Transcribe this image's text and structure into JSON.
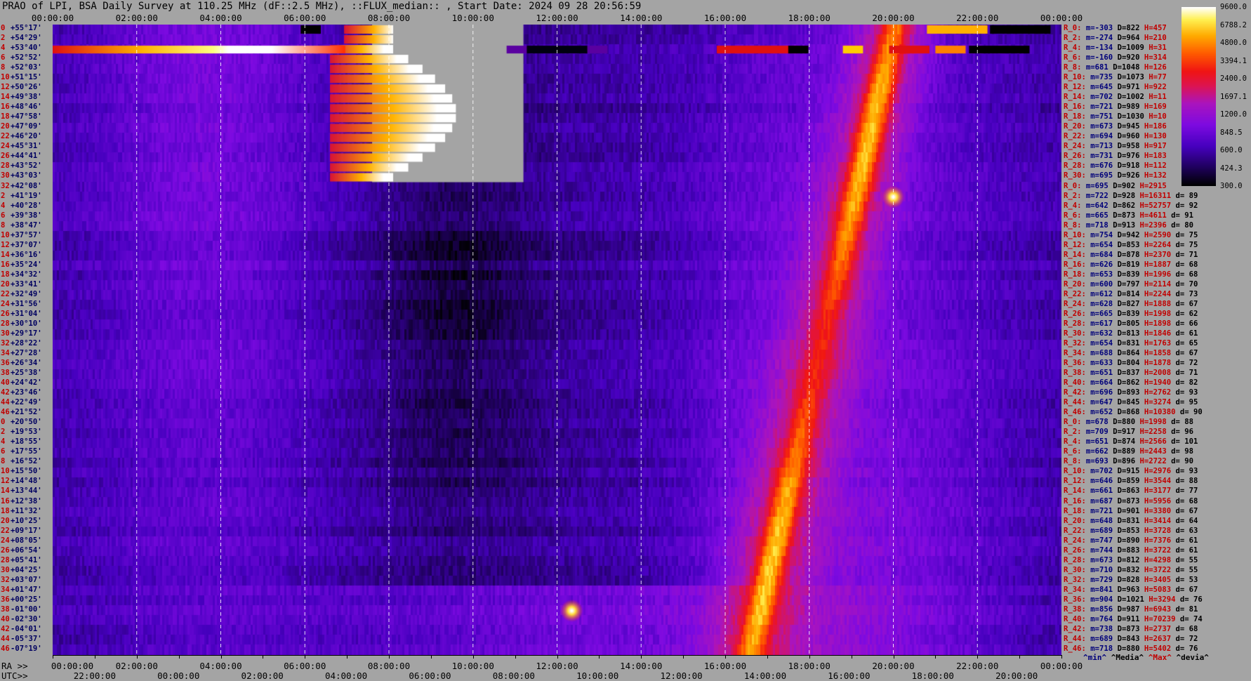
{
  "title": "PRAO of LPI, BSA Daily Survey at 110.25 MHz (dF::2.5 MHz), ::FLUX_median:: , Start Date: 2024 09 28 20:56:59",
  "colors": {
    "background": "#a4a4a4",
    "grid": "#ffffff",
    "row_number": "#c00000",
    "declination": "#000060"
  },
  "top_axis": [
    "00:00:00",
    "02:00:00",
    "04:00:00",
    "06:00:00",
    "08:00:00",
    "10:00:00",
    "12:00:00",
    "14:00:00",
    "16:00:00",
    "18:00:00",
    "20:00:00",
    "22:00:00",
    "00:00:00"
  ],
  "bottom_axis": {
    "ra_prefix": "RA >>",
    "utc_prefix": "UTC>>",
    "ra_labels": [
      "00:00:00",
      "02:00:00",
      "04:00:00",
      "06:00:00",
      "08:00:00",
      "10:00:00",
      "12:00:00",
      "14:00:00",
      "16:00:00",
      "18:00:00",
      "20:00:00",
      "22:00:00",
      "00:00:00"
    ],
    "utc_labels": [
      "22:00:00",
      "00:00:00",
      "02:00:00",
      "04:00:00",
      "06:00:00",
      "08:00:00",
      "10:00:00",
      "12:00:00",
      "14:00:00",
      "16:00:00",
      "18:00:00",
      "20:00:00"
    ]
  },
  "beams": [
    {
      "n": "0",
      "dec": "+55°17'"
    },
    {
      "n": "2",
      "dec": "+54°29'"
    },
    {
      "n": "4",
      "dec": "+53°40'"
    },
    {
      "n": "6",
      "dec": "+52°52'"
    },
    {
      "n": "8",
      "dec": "+52°03'"
    },
    {
      "n": "10",
      "dec": "+51°15'"
    },
    {
      "n": "12",
      "dec": "+50°26'"
    },
    {
      "n": "14",
      "dec": "+49°38'"
    },
    {
      "n": "16",
      "dec": "+48°46'"
    },
    {
      "n": "18",
      "dec": "+47°58'"
    },
    {
      "n": "20",
      "dec": "+47°09'"
    },
    {
      "n": "22",
      "dec": "+46°20'"
    },
    {
      "n": "24",
      "dec": "+45°31'"
    },
    {
      "n": "26",
      "dec": "+44°41'"
    },
    {
      "n": "28",
      "dec": "+43°52'"
    },
    {
      "n": "30",
      "dec": "+43°03'"
    },
    {
      "n": "32",
      "dec": "+42°08'"
    },
    {
      "n": "2",
      "dec": "+41°19'"
    },
    {
      "n": "4",
      "dec": "+40°28'"
    },
    {
      "n": "6",
      "dec": "+39°38'"
    },
    {
      "n": "8",
      "dec": "+38°47'"
    },
    {
      "n": "10",
      "dec": "+37°57'"
    },
    {
      "n": "12",
      "dec": "+37°07'"
    },
    {
      "n": "14",
      "dec": "+36°16'"
    },
    {
      "n": "16",
      "dec": "+35°24'"
    },
    {
      "n": "18",
      "dec": "+34°32'"
    },
    {
      "n": "20",
      "dec": "+33°41'"
    },
    {
      "n": "22",
      "dec": "+32°49'"
    },
    {
      "n": "24",
      "dec": "+31°56'"
    },
    {
      "n": "26",
      "dec": "+31°04'"
    },
    {
      "n": "28",
      "dec": "+30°10'"
    },
    {
      "n": "30",
      "dec": "+29°17'"
    },
    {
      "n": "32",
      "dec": "+28°22'"
    },
    {
      "n": "34",
      "dec": "+27°28'"
    },
    {
      "n": "36",
      "dec": "+26°34'"
    },
    {
      "n": "38",
      "dec": "+25°38'"
    },
    {
      "n": "40",
      "dec": "+24°42'"
    },
    {
      "n": "42",
      "dec": "+23°46'"
    },
    {
      "n": "44",
      "dec": "+22°49'"
    },
    {
      "n": "46",
      "dec": "+21°52'"
    },
    {
      "n": "0",
      "dec": "+20°50'"
    },
    {
      "n": "2",
      "dec": "+19°53'"
    },
    {
      "n": "4",
      "dec": "+18°55'"
    },
    {
      "n": "6",
      "dec": "+17°55'"
    },
    {
      "n": "8",
      "dec": "+16°52'"
    },
    {
      "n": "10",
      "dec": "+15°50'"
    },
    {
      "n": "12",
      "dec": "+14°48'"
    },
    {
      "n": "14",
      "dec": "+13°44'"
    },
    {
      "n": "16",
      "dec": "+12°38'"
    },
    {
      "n": "18",
      "dec": "+11°32'"
    },
    {
      "n": "20",
      "dec": "+10°25'"
    },
    {
      "n": "22",
      "dec": "+09°17'"
    },
    {
      "n": "24",
      "dec": "+08°05'"
    },
    {
      "n": "26",
      "dec": "+06°54'"
    },
    {
      "n": "28",
      "dec": "+05°41'"
    },
    {
      "n": "30",
      "dec": "+04°25'"
    },
    {
      "n": "32",
      "dec": "+03°07'"
    },
    {
      "n": "34",
      "dec": "+01°47'"
    },
    {
      "n": "36",
      "dec": "+00°25'"
    },
    {
      "n": "38",
      "dec": "-01°00'"
    },
    {
      "n": "40",
      "dec": "-02°30'"
    },
    {
      "n": "42",
      "dec": "-04°01'"
    },
    {
      "n": "44",
      "dec": "-05°37'"
    },
    {
      "n": "46",
      "dec": "-07°19'"
    }
  ],
  "stats": [
    {
      "r": "R_0:",
      "m": "m=-303",
      "d": "D=822",
      "h": "H=457",
      "v": ""
    },
    {
      "r": "R_2:",
      "m": "m=-274",
      "d": "D=964",
      "h": "H=210",
      "v": ""
    },
    {
      "r": "R_4:",
      "m": "m=-134",
      "d": "D=1009",
      "h": "H=31",
      "v": ""
    },
    {
      "r": "R_6:",
      "m": "m=-160",
      "d": "D=920",
      "h": "H=314",
      "v": ""
    },
    {
      "r": "R_8:",
      "m": "m=681",
      "d": "D=1048",
      "h": "H=126",
      "v": ""
    },
    {
      "r": "R_10:",
      "m": "m=735",
      "d": "D=1073",
      "h": "H=77",
      "v": ""
    },
    {
      "r": "R_12:",
      "m": "m=645",
      "d": "D=971",
      "h": "H=922",
      "v": ""
    },
    {
      "r": "R_14:",
      "m": "m=702",
      "d": "D=1002",
      "h": "H=11",
      "v": ""
    },
    {
      "r": "R_16:",
      "m": "m=721",
      "d": "D=989",
      "h": "H=169",
      "v": ""
    },
    {
      "r": "R_18:",
      "m": "m=751",
      "d": "D=1030",
      "h": "H=10",
      "v": ""
    },
    {
      "r": "R_20:",
      "m": "m=673",
      "d": "D=945",
      "h": "H=186",
      "v": ""
    },
    {
      "r": "R_22:",
      "m": "m=694",
      "d": "D=960",
      "h": "H=130",
      "v": ""
    },
    {
      "r": "R_24:",
      "m": "m=713",
      "d": "D=958",
      "h": "H=917",
      "v": ""
    },
    {
      "r": "R_26:",
      "m": "m=731",
      "d": "D=976",
      "h": "H=183",
      "v": ""
    },
    {
      "r": "R_28:",
      "m": "m=676",
      "d": "D=918",
      "h": "H=112",
      "v": ""
    },
    {
      "r": "R_30:",
      "m": "m=695",
      "d": "D=926",
      "h": "H=132",
      "v": ""
    },
    {
      "r": "R_0:",
      "m": "m=695",
      "d": "D=902",
      "h": "H=2915",
      "v": ""
    },
    {
      "r": "R_2:",
      "m": "m=722",
      "d": "D=928",
      "h": "H=16311",
      "v": "d= 89"
    },
    {
      "r": "R_4:",
      "m": "m=642",
      "d": "D=862",
      "h": "H=52757",
      "v": "d= 92"
    },
    {
      "r": "R_6:",
      "m": "m=665",
      "d": "D=873",
      "h": "H=4611",
      "v": "d= 91"
    },
    {
      "r": "R_8:",
      "m": "m=718",
      "d": "D=913",
      "h": "H=2396",
      "v": "d= 80"
    },
    {
      "r": "R_10:",
      "m": "m=754",
      "d": "D=942",
      "h": "H=2590",
      "v": "d= 75"
    },
    {
      "r": "R_12:",
      "m": "m=654",
      "d": "D=853",
      "h": "H=2264",
      "v": "d= 75"
    },
    {
      "r": "R_14:",
      "m": "m=684",
      "d": "D=878",
      "h": "H=2370",
      "v": "d= 71"
    },
    {
      "r": "R_16:",
      "m": "m=626",
      "d": "D=819",
      "h": "H=1887",
      "v": "d= 68"
    },
    {
      "r": "R_18:",
      "m": "m=653",
      "d": "D=839",
      "h": "H=1996",
      "v": "d= 68"
    },
    {
      "r": "R_20:",
      "m": "m=600",
      "d": "D=797",
      "h": "H=2114",
      "v": "d= 70"
    },
    {
      "r": "R_22:",
      "m": "m=612",
      "d": "D=814",
      "h": "H=2244",
      "v": "d= 73"
    },
    {
      "r": "R_24:",
      "m": "m=628",
      "d": "D=827",
      "h": "H=1888",
      "v": "d= 67"
    },
    {
      "r": "R_26:",
      "m": "m=665",
      "d": "D=839",
      "h": "H=1998",
      "v": "d= 62"
    },
    {
      "r": "R_28:",
      "m": "m=617",
      "d": "D=805",
      "h": "H=1898",
      "v": "d= 66"
    },
    {
      "r": "R_30:",
      "m": "m=632",
      "d": "D=813",
      "h": "H=1846",
      "v": "d= 61"
    },
    {
      "r": "R_32:",
      "m": "m=654",
      "d": "D=831",
      "h": "H=1763",
      "v": "d= 65"
    },
    {
      "r": "R_34:",
      "m": "m=688",
      "d": "D=864",
      "h": "H=1858",
      "v": "d= 67"
    },
    {
      "r": "R_36:",
      "m": "m=633",
      "d": "D=804",
      "h": "H=1878",
      "v": "d= 72"
    },
    {
      "r": "R_38:",
      "m": "m=651",
      "d": "D=837",
      "h": "H=2008",
      "v": "d= 71"
    },
    {
      "r": "R_40:",
      "m": "m=664",
      "d": "D=862",
      "h": "H=1940",
      "v": "d= 82"
    },
    {
      "r": "R_42:",
      "m": "m=696",
      "d": "D=893",
      "h": "H=2762",
      "v": "d= 93"
    },
    {
      "r": "R_44:",
      "m": "m=647",
      "d": "D=845",
      "h": "H=3274",
      "v": "d= 95"
    },
    {
      "r": "R_46:",
      "m": "m=652",
      "d": "D=868",
      "h": "H=10380",
      "v": "d= 90"
    },
    {
      "r": "R_0:",
      "m": "m=678",
      "d": "D=880",
      "h": "H=1998",
      "v": "d= 88"
    },
    {
      "r": "R_2:",
      "m": "m=709",
      "d": "D=917",
      "h": "H=2258",
      "v": "d= 96"
    },
    {
      "r": "R_4:",
      "m": "m=651",
      "d": "D=874",
      "h": "H=2566",
      "v": "d= 101"
    },
    {
      "r": "R_6:",
      "m": "m=662",
      "d": "D=889",
      "h": "H=2443",
      "v": "d= 98"
    },
    {
      "r": "R_8:",
      "m": "m=693",
      "d": "D=896",
      "h": "H=2722",
      "v": "d= 90"
    },
    {
      "r": "R_10:",
      "m": "m=702",
      "d": "D=915",
      "h": "H=2976",
      "v": "d= 93"
    },
    {
      "r": "R_12:",
      "m": "m=646",
      "d": "D=859",
      "h": "H=3544",
      "v": "d= 88"
    },
    {
      "r": "R_14:",
      "m": "m=661",
      "d": "D=863",
      "h": "H=3177",
      "v": "d= 77"
    },
    {
      "r": "R_16:",
      "m": "m=687",
      "d": "D=873",
      "h": "H=5956",
      "v": "d= 68"
    },
    {
      "r": "R_18:",
      "m": "m=721",
      "d": "D=901",
      "h": "H=3380",
      "v": "d= 67"
    },
    {
      "r": "R_20:",
      "m": "m=648",
      "d": "D=831",
      "h": "H=3414",
      "v": "d= 64"
    },
    {
      "r": "R_22:",
      "m": "m=689",
      "d": "D=853",
      "h": "H=3728",
      "v": "d= 63"
    },
    {
      "r": "R_24:",
      "m": "m=747",
      "d": "D=890",
      "h": "H=7376",
      "v": "d= 61"
    },
    {
      "r": "R_26:",
      "m": "m=744",
      "d": "D=883",
      "h": "H=3722",
      "v": "d= 61"
    },
    {
      "r": "R_28:",
      "m": "m=673",
      "d": "D=812",
      "h": "H=4298",
      "v": "d= 55"
    },
    {
      "r": "R_30:",
      "m": "m=710",
      "d": "D=832",
      "h": "H=3722",
      "v": "d= 55"
    },
    {
      "r": "R_32:",
      "m": "m=729",
      "d": "D=828",
      "h": "H=3405",
      "v": "d= 53"
    },
    {
      "r": "R_34:",
      "m": "m=841",
      "d": "D=963",
      "h": "H=5083",
      "v": "d= 67"
    },
    {
      "r": "R_36:",
      "m": "m=904",
      "d": "D=1021",
      "h": "H=3294",
      "v": "d= 76"
    },
    {
      "r": "R_38:",
      "m": "m=856",
      "d": "D=987",
      "h": "H=6943",
      "v": "d= 81"
    },
    {
      "r": "R_40:",
      "m": "m=764",
      "d": "D=911",
      "h": "H=70239",
      "v": "d= 74"
    },
    {
      "r": "R_42:",
      "m": "m=738",
      "d": "D=873",
      "h": "H=2737",
      "v": "d= 68"
    },
    {
      "r": "R_44:",
      "m": "m=689",
      "d": "D=843",
      "h": "H=2637",
      "v": "d= 72"
    },
    {
      "r": "R_46:",
      "m": "m=718",
      "d": "D=880",
      "h": "H=5402",
      "v": "d= 76"
    }
  ],
  "stats_footer": {
    "min": "^min^",
    "median": "^Media^",
    "max": "^Max^",
    "devia": "^devia^"
  },
  "colorbar_ticks": [
    "9600.0",
    "6788.2",
    "4800.0",
    "3394.1",
    "2400.0",
    "1697.1",
    "1200.0",
    "848.5",
    "600.0",
    "424.3",
    "300.0"
  ],
  "chart_data": {
    "type": "heatmap",
    "title": "PRAO of LPI, BSA Daily Survey at 110.25 MHz (dF::2.5 MHz), ::FLUX_median:: , Start Date: 2024 09 28 20:56:59",
    "x_axis": "RA / UTC (hours)",
    "x_range": [
      0,
      24
    ],
    "y_axis": "beam declination",
    "beam_count": 64,
    "color_scale": "log",
    "color_range": [
      300,
      9600
    ],
    "grid": true,
    "features": [
      {
        "type": "drift-track",
        "ra_start": 16.6,
        "ra_end": 20.0,
        "desc": "bright source track"
      },
      {
        "type": "point-source",
        "ra": 20.0,
        "beam_index": 17
      },
      {
        "type": "point-source",
        "ra": 12.35,
        "beam_index": 59
      },
      {
        "type": "blank-region",
        "ra_start": 7.6,
        "ra_end": 11.2,
        "beam_start": 0,
        "beam_end": 15
      }
    ]
  }
}
